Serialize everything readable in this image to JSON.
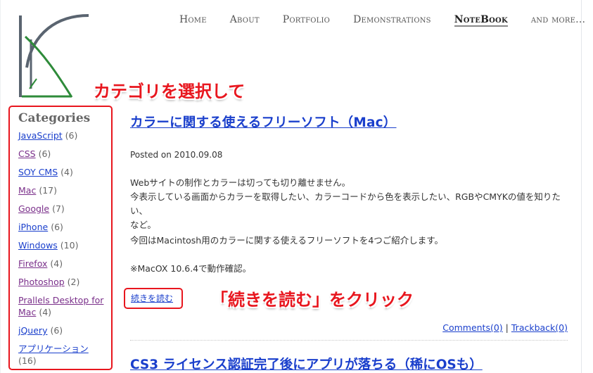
{
  "nav": {
    "items": [
      "Home",
      "About",
      "Portfolio",
      "Demonstrations",
      "NoteBook",
      "and more..."
    ],
    "active": "NoteBook"
  },
  "annotations": {
    "select_category": "カテゴリを選択して",
    "click_more": "「続きを読む」をクリック"
  },
  "sidebar": {
    "title": "Categories",
    "categories": [
      {
        "label": "JavaScript",
        "count": "(6)"
      },
      {
        "label": "CSS",
        "count": "(6)"
      },
      {
        "label": "SOY CMS",
        "count": "(4)"
      },
      {
        "label": "Mac",
        "count": "(17)"
      },
      {
        "label": "Google",
        "count": "(7)"
      },
      {
        "label": "iPhone",
        "count": "(6)"
      },
      {
        "label": "Windows",
        "count": "(10)"
      },
      {
        "label": "Firefox",
        "count": "(4)"
      },
      {
        "label": "Photoshop",
        "count": "(2)"
      },
      {
        "label": "Prallels Desktop for Mac",
        "count": "(4)"
      },
      {
        "label": "jQuery",
        "count": "(6)"
      },
      {
        "label": "アプリケーション",
        "count": "(16)"
      }
    ]
  },
  "post": {
    "title": "カラーに関する使えるフリーソフト（Mac）",
    "posted": "Posted on 2010.09.08",
    "para1_line1": "Webサイトの制作とカラーは切っても切り離せません。",
    "para1_line2": "今表示している画面からカラーを取得したい、カラーコードから色を表示したい、RGBやCMYKの値を知りたい、",
    "para1_line3": "など。",
    "para2": "今回はMacintosh用のカラーに関する使えるフリーソフトを4つご紹介します。",
    "para3": "※MacOX 10.6.4で動作確認。",
    "more": "続きを読む",
    "comments": "Comments(0)",
    "separator": "|",
    "trackback": "Trackback(0)"
  },
  "next_post": {
    "title": "CS3 ライセンス認証完了後にアプリが落ちる（稀にOSも）"
  },
  "colors": {
    "accent_red": "#e8161e",
    "link_blue": "#1a3fcc",
    "visited_purple": "#7a2f8a",
    "logo_gray": "#5a6470",
    "logo_green": "#2e8b3a"
  }
}
